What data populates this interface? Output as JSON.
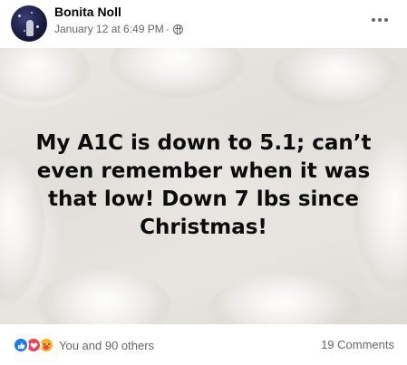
{
  "post": {
    "author": "Bonita Noll",
    "timestamp": "January 12 at 6:49 PM",
    "separator": "·",
    "privacy_icon": "globe-icon",
    "more_icon": "more-options-icon",
    "image": {
      "description_icon": "white-knit-blanket",
      "caption": "My A1C is down to 5.1; can’t even remember when it was that low! Down 7 lbs since Christmas!"
    },
    "reactions": {
      "icons": [
        "like-icon",
        "love-icon",
        "care-icon"
      ],
      "summary": "You and 90 others"
    },
    "comments": "19 Comments"
  },
  "colors": {
    "like": "#1877f2",
    "love": "#f33e58",
    "care": "#f7b125",
    "secondary_text": "#65676b"
  }
}
